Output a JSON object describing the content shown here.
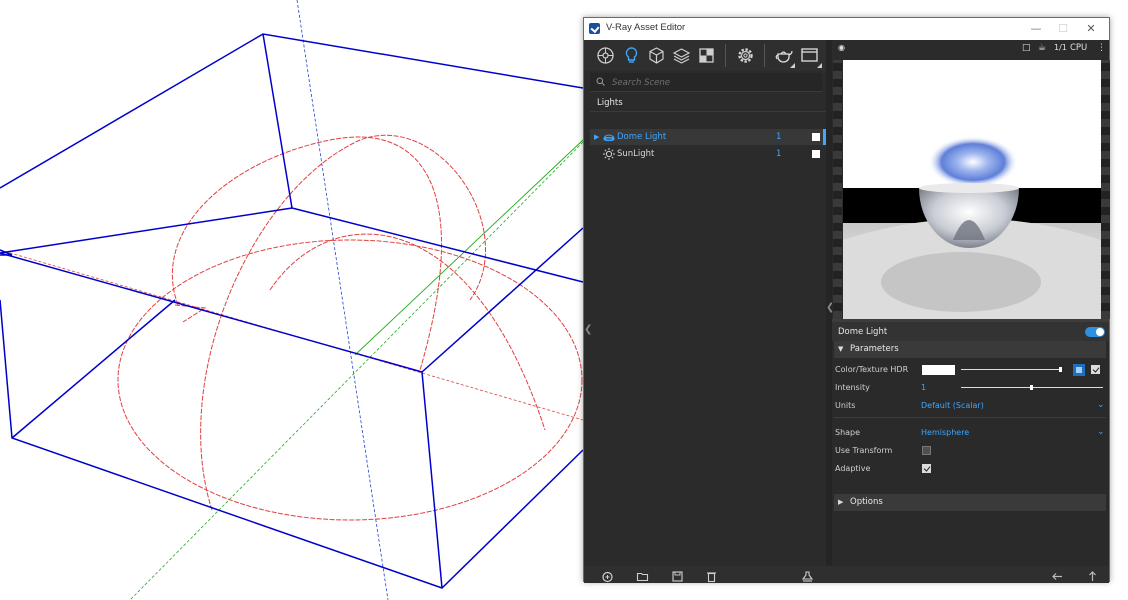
{
  "window": {
    "title": "V-Ray Asset Editor"
  },
  "toolbar": {
    "items": [
      "materials-icon",
      "lights-icon",
      "geometry-icon",
      "layers-icon",
      "textures-icon",
      "settings-icon",
      "render-teapot-icon",
      "frame-buffer-icon"
    ]
  },
  "search": {
    "placeholder": "Search Scene",
    "value": ""
  },
  "list": {
    "category": "Lights",
    "items": [
      {
        "name": "Dome Light",
        "count": "1",
        "selected": true,
        "icon": "dome-light-icon",
        "enabled": true
      },
      {
        "name": "SunLight",
        "count": "1",
        "selected": false,
        "icon": "sun-light-icon",
        "enabled": true
      }
    ]
  },
  "preview": {
    "render_mode": "CPU",
    "toolbar_icons": [
      "eye-icon",
      "stop-icon",
      "teapot-icon",
      "ratio-icon",
      "cpu-label",
      "more-icon"
    ]
  },
  "params": {
    "title": "Dome Light",
    "enabled": true,
    "sections": {
      "parameters": "Parameters",
      "options": "Options"
    },
    "color_texture": {
      "label": "Color/Texture HDR",
      "color": "#ffffff",
      "multiplier_fraction": 0.98,
      "texture_enabled": true
    },
    "intensity": {
      "label": "Intensity",
      "value": "1",
      "slider_fraction": 0.5
    },
    "units": {
      "label": "Units",
      "value": "Default (Scalar)"
    },
    "shape": {
      "label": "Shape",
      "value": "Hemisphere"
    },
    "use_transform": {
      "label": "Use Transform",
      "checked": false
    },
    "adaptive": {
      "label": "Adaptive",
      "checked": true
    }
  },
  "bottom_bar": {
    "icons": [
      "add-icon",
      "open-folder-icon",
      "save-icon",
      "delete-icon",
      "purge-icon",
      "back-arrow-icon",
      "up-arrow-icon"
    ]
  },
  "colors": {
    "accent": "#3ea7ff",
    "panel": "#2b2b2b",
    "viewport_box": "#0000cc",
    "viewport_light": "#e04040",
    "axis_green": "#00aa00",
    "axis_red": "#cc3333"
  }
}
